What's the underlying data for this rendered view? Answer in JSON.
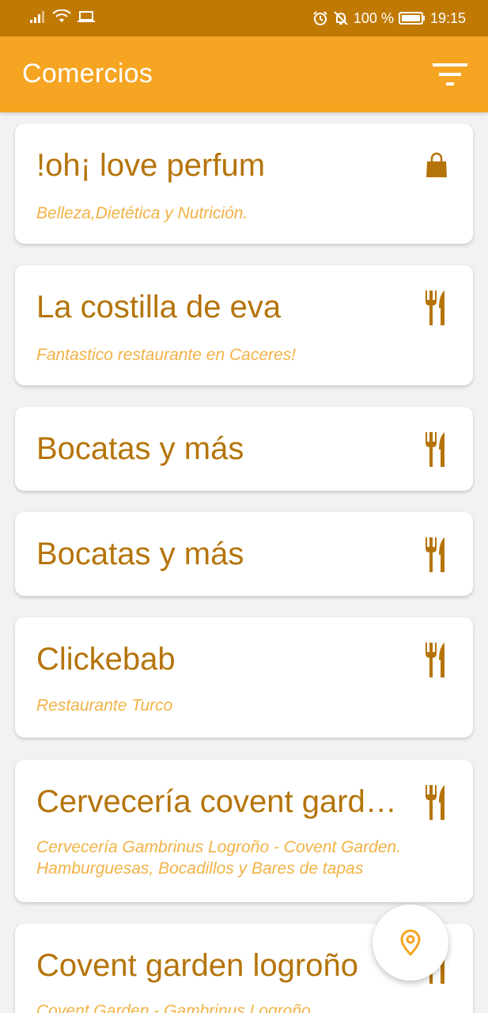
{
  "status_bar": {
    "battery": "100 %",
    "time": "19:15"
  },
  "app_bar": {
    "title": "Comercios",
    "filter_icon": "filter-icon"
  },
  "colors": {
    "status_bar": "#c07a04",
    "app_bar": "#f6a523",
    "title_text": "#b5740a",
    "subtitle_text": "#f2b245"
  },
  "cards": [
    {
      "title": "!oh¡ love perfum",
      "subtitle": "Belleza,Dietética y Nutrición.",
      "icon": "shopping-bag-icon"
    },
    {
      "title": "La costilla de eva",
      "subtitle": "Fantastico restaurante en Caceres!",
      "icon": "fork-knife-icon"
    },
    {
      "title": "Bocatas y más",
      "subtitle": "",
      "icon": "fork-knife-icon"
    },
    {
      "title": "Bocatas y más",
      "subtitle": "",
      "icon": "fork-knife-icon"
    },
    {
      "title": "Clickebab",
      "subtitle": "Restaurante Turco",
      "icon": "fork-knife-icon"
    },
    {
      "title": "Cervecería covent garde...",
      "subtitle": "Cervecería Gambrinus Logroño - Covent Garden. Hamburguesas, Bocadillos y Bares de tapas",
      "icon": "fork-knife-icon"
    },
    {
      "title": "Covent garden logroño",
      "subtitle": "Covent Garden - Gambrinus Logroño",
      "icon": "fork-knife-icon"
    }
  ],
  "fab": {
    "icon": "location-pin-icon"
  }
}
